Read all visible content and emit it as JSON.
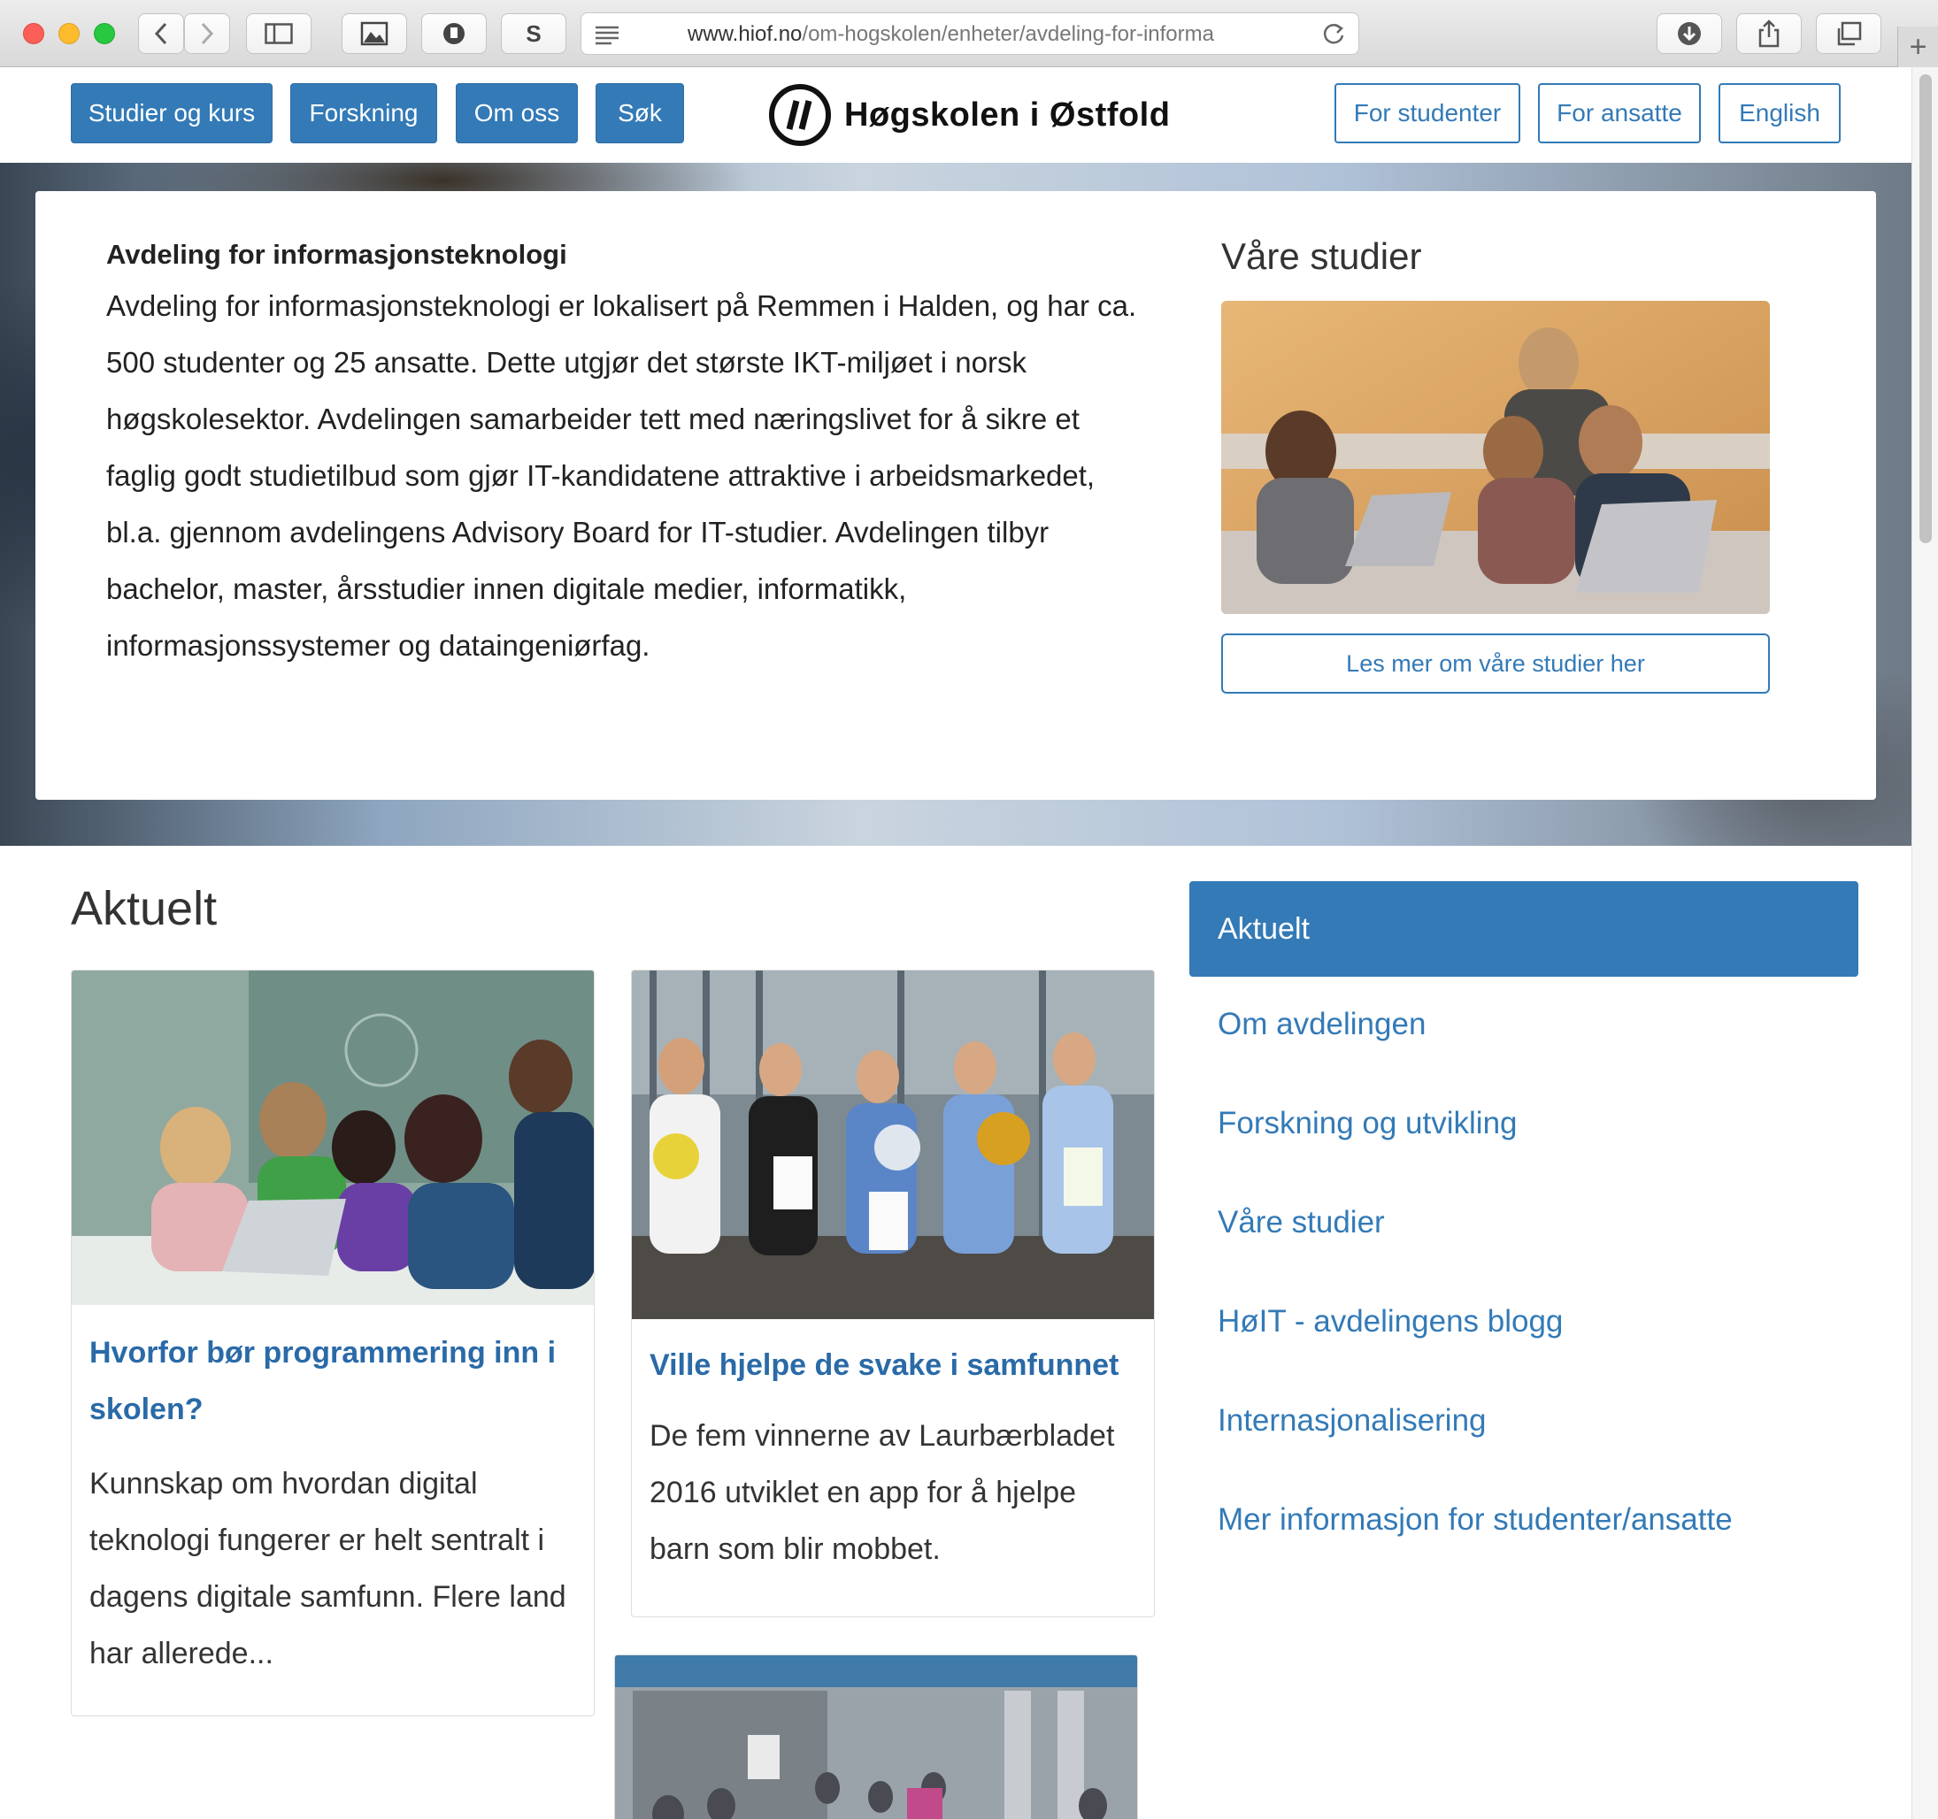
{
  "browser": {
    "url_host": "www.hiof.no",
    "url_path": "/om-hogskolen/enheter/avdeling-for-informa",
    "s_label": "S"
  },
  "header": {
    "nav": [
      "Studier og kurs",
      "Forskning",
      "Om oss",
      "Søk"
    ],
    "logo_text": "Høgskolen i Østfold",
    "right_links": [
      "For studenter",
      "For ansatte",
      "English"
    ]
  },
  "hero": {
    "title": "Avdeling for informasjonsteknologi",
    "lines": [
      "Avdeling for informasjonsteknologi er lokalisert på Remmen i Halden, og har ca.",
      "500 studenter og 25 ansatte. Dette utgjør det største IKT-miljøet i norsk",
      "høgskolesektor. Avdelingen samarbeider tett med næringslivet for å sikre et",
      "faglig godt studietilbud som gjør IT-kandidatene attraktive i arbeidsmarkedet,",
      "bl.a. gjennom avdelingens Advisory Board for IT-studier. Avdelingen tilbyr",
      "bachelor, master, årsstudier innen digitale medier, informatikk,",
      "informasjonssystemer og dataingeniørfag."
    ],
    "studier_heading": "Våre studier",
    "studier_button": "Les mer om våre studier her"
  },
  "aktuelt": {
    "heading": "Aktuelt",
    "cards": [
      {
        "title_lines": [
          "Hvorfor bør programmering inn i",
          "skolen?"
        ],
        "body_lines": [
          "Kunnskap om hvordan digital",
          "teknologi fungerer er helt sentralt i",
          "dagens digitale samfunn. Flere land",
          "har allerede..."
        ]
      },
      {
        "title_lines": [
          "Ville hjelpe de svake i samfunnet"
        ],
        "body_lines": [
          "De fem vinnerne av Laurbærbladet",
          "2016 utviklet en app for å hjelpe",
          "barn som blir mobbet."
        ]
      }
    ]
  },
  "sidebar": {
    "active": "Aktuelt",
    "links": [
      "Om avdelingen",
      "Forskning og utvikling",
      "Våre studier",
      "HøIT - avdelingens blogg",
      "Internasjonalisering",
      "Mer informasjon for studenter/ansatte"
    ]
  },
  "colors": {
    "primary": "#337ab7",
    "link": "#2a6aa7"
  }
}
